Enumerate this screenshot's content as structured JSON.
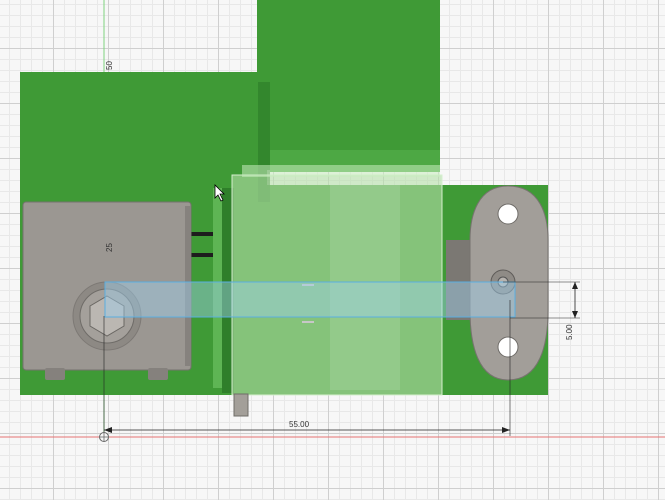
{
  "viewport": {
    "dimensions": {
      "vertical_top": "50",
      "vertical_mid": "25",
      "horizontal": "55.00",
      "offset": "5.00"
    }
  },
  "colors": {
    "green": "#3f9a36",
    "green_dark": "#2f7f2a",
    "green_light": "#88c878",
    "gray_block": "#9b9792",
    "gray_dark": "#6f6c68",
    "selection": "#9fd0ee",
    "axis_red": "#e57373",
    "axis_green": "#7fd37f"
  }
}
